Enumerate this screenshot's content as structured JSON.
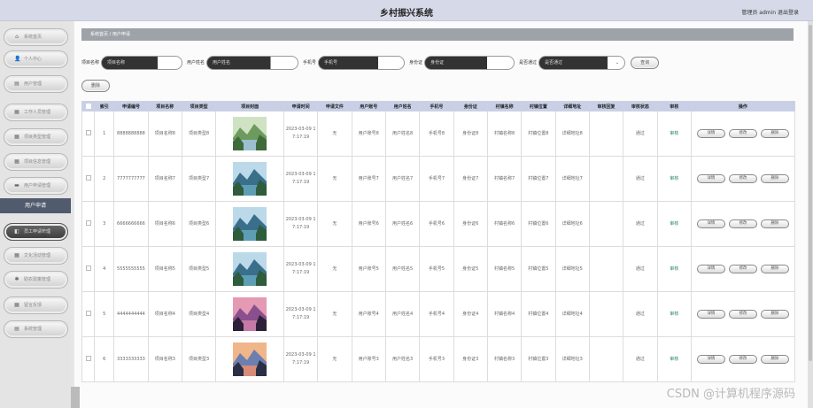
{
  "header": {
    "title": "乡村振兴系统",
    "user_text": "管理员 admin  退出登录"
  },
  "sidebar": {
    "items": [
      {
        "label": "系统首页",
        "icon": "home-icon"
      },
      {
        "label": "个人中心",
        "icon": "user-icon"
      },
      {
        "label": "用户管理",
        "icon": "list-icon"
      },
      {
        "label": "工作人员管理",
        "icon": "grid-icon"
      },
      {
        "label": "项目类型管理",
        "icon": "grid-icon"
      },
      {
        "label": "项目信息管理",
        "icon": "grid-icon"
      },
      {
        "label": "用户申请管理",
        "icon": "chat-icon"
      },
      {
        "label": "员工申请管理",
        "icon": "doc-icon"
      },
      {
        "label": "文化活动管理",
        "icon": "grid-icon"
      },
      {
        "label": "助农政策管理",
        "icon": "gear-icon"
      },
      {
        "label": "留言反馈",
        "icon": "grid-icon"
      },
      {
        "label": "系统管理",
        "icon": "list-icon"
      }
    ],
    "active_submenu": "用户申请"
  },
  "breadcrumb": {
    "text": "系统首页 / 用户申请"
  },
  "search": {
    "fields": [
      {
        "label": "项目名称",
        "placeholder": "项目名称"
      },
      {
        "label": "用户姓名",
        "placeholder": "用户姓名"
      },
      {
        "label": "手机号",
        "placeholder": "手机号"
      },
      {
        "label": "身份证",
        "placeholder": "身份证"
      }
    ],
    "select_label": "是否通过",
    "select_placeholder": "是否通过",
    "query_button": "查询",
    "delete_button": "删除"
  },
  "table": {
    "headers": [
      "",
      "索引",
      "申请编号",
      "项目名称",
      "项目类型",
      "项目封面",
      "申请时间",
      "申请文件",
      "用户账号",
      "用户姓名",
      "手机号",
      "身份证",
      "村镇名称",
      "村镇位置",
      "详细地址",
      "审核回复",
      "审核状态",
      "审核",
      "操作"
    ],
    "rows": [
      {
        "index": "1",
        "code": "8888888888",
        "project": "项目名称8",
        "type": "项目类型8",
        "time": "2023-03-09 17:17:19",
        "file": "无",
        "account": "用户账号8",
        "name": "用户姓名8",
        "phone": "手机号8",
        "idcard": "身份证8",
        "village": "村镇名称8",
        "location": "村镇位置8",
        "address": "详细地址8",
        "reply": "",
        "status": "通过",
        "audit": "审核",
        "cover": "forest"
      },
      {
        "index": "2",
        "code": "7777777777",
        "project": "项目名称7",
        "type": "项目类型7",
        "time": "2023-03-09 17:17:19",
        "file": "无",
        "account": "用户账号7",
        "name": "用户姓名7",
        "phone": "手机号7",
        "idcard": "身份证7",
        "village": "村镇名称7",
        "location": "村镇位置7",
        "address": "详细地址7",
        "reply": "",
        "status": "通过",
        "audit": "审核",
        "cover": "lake"
      },
      {
        "index": "3",
        "code": "6666666666",
        "project": "项目名称6",
        "type": "项目类型6",
        "time": "2023-03-09 17:17:19",
        "file": "无",
        "account": "用户账号6",
        "name": "用户姓名6",
        "phone": "手机号6",
        "idcard": "身份证6",
        "village": "村镇名称6",
        "location": "村镇位置6",
        "address": "详细地址6",
        "reply": "",
        "status": "通过",
        "audit": "审核",
        "cover": "lake"
      },
      {
        "index": "4",
        "code": "5555555555",
        "project": "项目名称5",
        "type": "项目类型5",
        "time": "2023-03-09 17:17:19",
        "file": "无",
        "account": "用户账号5",
        "name": "用户姓名5",
        "phone": "手机号5",
        "idcard": "身份证5",
        "village": "村镇名称5",
        "location": "村镇位置5",
        "address": "详细地址5",
        "reply": "",
        "status": "通过",
        "audit": "审核",
        "cover": "lake"
      },
      {
        "index": "5",
        "code": "4444444444",
        "project": "项目名称4",
        "type": "项目类型4",
        "time": "2023-03-09 17:17:19",
        "file": "无",
        "account": "用户账号4",
        "name": "用户姓名4",
        "phone": "手机号4",
        "idcard": "身份证4",
        "village": "村镇名称4",
        "location": "村镇位置4",
        "address": "详细地址4",
        "reply": "",
        "status": "通过",
        "audit": "审核",
        "cover": "sunset"
      },
      {
        "index": "6",
        "code": "3333333333",
        "project": "项目名称3",
        "type": "项目类型3",
        "time": "2023-03-09 17:17:19",
        "file": "无",
        "account": "用户账号3",
        "name": "用户姓名3",
        "phone": "手机号3",
        "idcard": "身份证3",
        "village": "村镇名称3",
        "location": "村镇位置3",
        "address": "详细地址3",
        "reply": "",
        "status": "通过",
        "audit": "审核",
        "cover": "dusk"
      }
    ],
    "row_actions": {
      "detail": "详情",
      "edit": "修改",
      "delete": "删除"
    }
  },
  "watermark": "CSDN @计算机程序源码",
  "colors": {
    "header_bg": "#d6dae8",
    "table_header_bg": "#c8cfe6",
    "active_submenu_bg": "#505b6e",
    "audit_link": "#2a8b5f"
  }
}
